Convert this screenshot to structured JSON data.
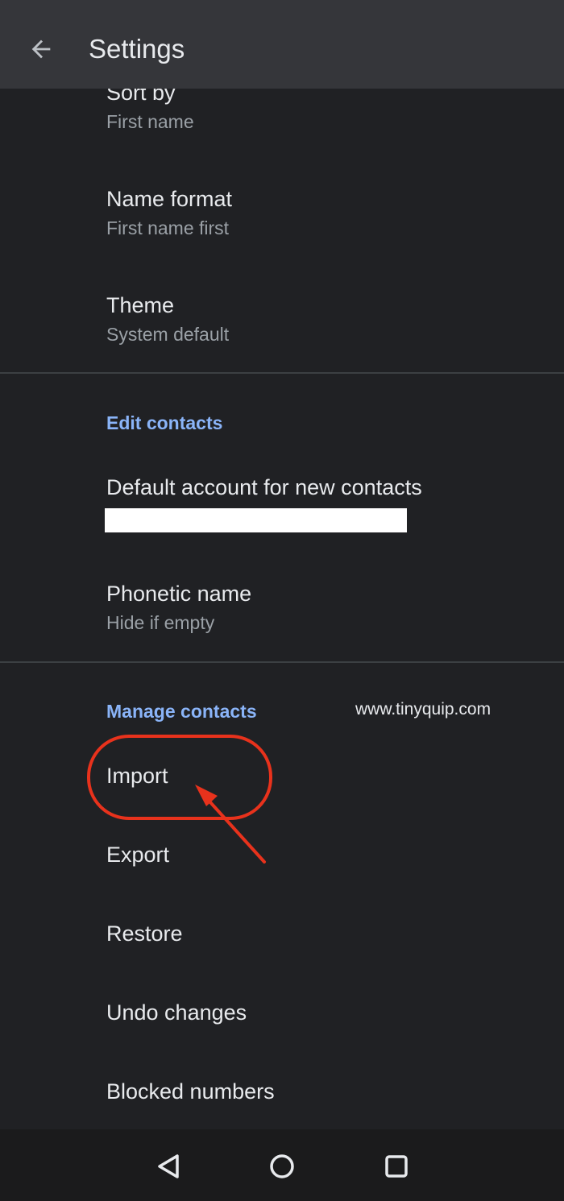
{
  "appbar": {
    "title": "Settings",
    "back_icon": "arrow-left-icon"
  },
  "display": {
    "items": [
      {
        "title": "Sort by",
        "subtitle": "First name"
      },
      {
        "title": "Name format",
        "subtitle": "First name first"
      },
      {
        "title": "Theme",
        "subtitle": "System default"
      }
    ]
  },
  "edit_contacts": {
    "header": "Edit contacts",
    "items": [
      {
        "title": "Default account for new contacts"
      },
      {
        "title": "Phonetic name",
        "subtitle": "Hide if empty"
      }
    ]
  },
  "manage_contacts": {
    "header": "Manage contacts",
    "items": [
      {
        "title": "Import"
      },
      {
        "title": "Export"
      },
      {
        "title": "Restore"
      },
      {
        "title": "Undo changes"
      },
      {
        "title": "Blocked numbers"
      }
    ]
  },
  "watermark": "www.tinyquip.com",
  "colors": {
    "background": "#202124",
    "appbar": "#35363a",
    "accent": "#8ab4f8",
    "annotation": "#e8321c",
    "navbar": "#1b1b1c"
  },
  "navbar": {
    "icons": [
      "back-triangle-icon",
      "home-circle-icon",
      "recents-square-icon"
    ]
  }
}
